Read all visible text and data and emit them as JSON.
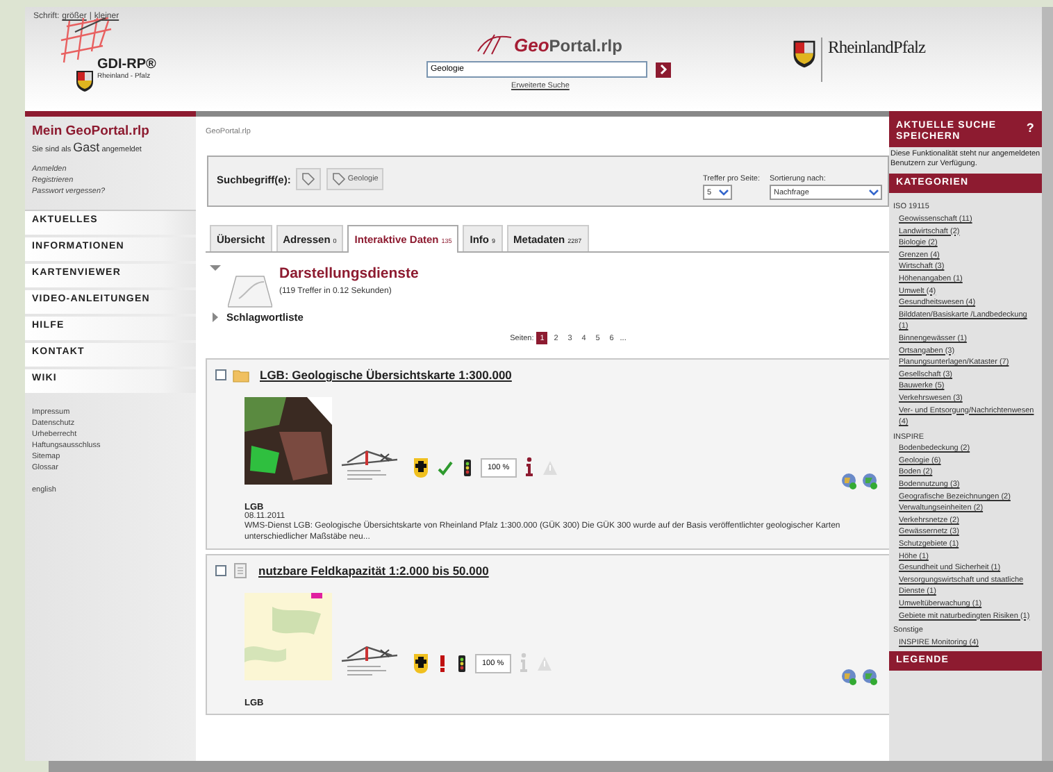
{
  "header": {
    "font_label": "Schrift:",
    "font_links": [
      "größer",
      "kleiner"
    ],
    "separator": "|",
    "gdi_logo": {
      "name": "GDI-RP®",
      "region": "Rheinland - Pfalz"
    },
    "portal_logo": "**Geo**Portal.rlp",
    "search": {
      "value": "Geologie"
    },
    "advanced_search": "Erweiterte Suche",
    "state_logo": "RheinlandPfalz"
  },
  "left": {
    "title": "Mein GeoPortal.rlp",
    "login_status": "Sie sind als **Gast** angemeldet",
    "account_links": [
      "Anmelden",
      "Registrieren",
      "Passwort vergessen?"
    ],
    "nav": [
      "AKTUELLES",
      "INFORMATIONEN",
      "KARTENVIEWER",
      "VIDEO-ANLEITUNGEN",
      "HILFE",
      "KONTAKT",
      "WIKI"
    ],
    "footer_links": [
      "Impressum",
      "Datenschutz",
      "Urheberrecht",
      "Haftungsausschluss",
      "Sitemap",
      "Glossar"
    ],
    "language": "english"
  },
  "main": {
    "breadcrumb": "GeoPortal.rlp",
    "search_terms_label": "Suchbegriff(e):",
    "search_terms": [
      "Geologie"
    ],
    "per_page": {
      "label": "Treffer pro Seite:",
      "value": "5"
    },
    "sort": {
      "label": "Sortierung nach:",
      "value": "Nachfrage"
    },
    "tabs": [
      {
        "label": "Übersicht",
        "selected": false
      },
      {
        "label": "Adressen",
        "count": "0",
        "selected": false
      },
      {
        "label": "Interaktive Daten",
        "count": "135",
        "selected": true
      },
      {
        "label": "Info",
        "count": "9",
        "selected": false
      },
      {
        "label": "Metadaten",
        "count": "2287",
        "selected": false
      }
    ],
    "section": {
      "title": "Darstellungsdienste",
      "expanded": true,
      "hits": "(119 Treffer in 0.12 Sekunden)"
    },
    "keyword_list": {
      "label": "Schlagwortliste",
      "expanded": false
    },
    "pages": {
      "label": "Seiten:",
      "items": [
        {
          "label": "1",
          "selected": true
        },
        {
          "label": "2",
          "selected": false
        },
        {
          "label": "3",
          "selected": false
        },
        {
          "label": "4",
          "selected": false
        },
        {
          "label": "5",
          "selected": false
        },
        {
          "label": "6",
          "selected": false
        }
      ],
      "more": "..."
    },
    "results": [
      {
        "checked": false,
        "kind": "folder",
        "title": "LGB: Geologische Übersichtskarte 1:300.000",
        "status_ok": true,
        "info_available": true,
        "zoom": "100 %",
        "provider": "LGB",
        "date": "08.11.2011",
        "description": "WMS-Dienst LGB: Geologische Übersichtskarte von Rheinland Pfalz 1:300.000 (GÜK 300) Die GÜK 300 wurde auf der Basis veröffentlichter geologischer Karten unterschiedlicher Maßstäbe neu..."
      },
      {
        "checked": false,
        "kind": "document",
        "title": "nutzbare Feldkapazität 1:2.000 bis 50.000",
        "status_ok": false,
        "info_available": false,
        "zoom": "100 %",
        "provider": "LGB"
      }
    ]
  },
  "right": {
    "save_search": {
      "title": "AKTUELLE SUCHE SPEICHERN",
      "help": "?",
      "note": "Diese Funktionalität steht nur angemeldeten Benutzern zur Verfügung."
    },
    "categories_title": "KATEGORIEN",
    "groups": [
      {
        "name": "ISO 19115",
        "items": [
          "Geowissenschaft (11)",
          "Landwirtschaft (2)",
          "Biologie (2)",
          "Grenzen (4)",
          "Wirtschaft (3)",
          "Höhenangaben (1)",
          "Umwelt (4)",
          "Gesundheitswesen (4)",
          "Bilddaten/Basiskarte /Landbedeckung (1)",
          "Binnengewässer (1)",
          "Ortsangaben (3)",
          "Planungsunterlagen/Kataster (7)",
          "Gesellschaft (3)",
          "Bauwerke (5)",
          "Verkehrswesen (3)",
          "Ver- und Entsorgung/Nachrichtenwesen (4)"
        ]
      },
      {
        "name": "INSPIRE",
        "items": [
          "Bodenbedeckung (2)",
          "Geologie (6)",
          "Boden (2)",
          "Bodennutzung (3)",
          "Geografische Bezeichnungen (2)",
          "Verwaltungseinheiten (2)",
          "Verkehrsnetze (2)",
          "Gewässernetz (3)",
          "Schutzgebiete (1)",
          "Höhe (1)",
          "Gesundheit und Sicherheit (1)",
          "Versorgungswirtschaft und staatliche Dienste (1)",
          "Umweltüberwachung (1)",
          "Gebiete mit naturbedingten Risiken (1)"
        ]
      },
      {
        "name": "Sonstige",
        "items": [
          "INSPIRE Monitoring (4)"
        ]
      }
    ],
    "legend_title": "LEGENDE"
  }
}
